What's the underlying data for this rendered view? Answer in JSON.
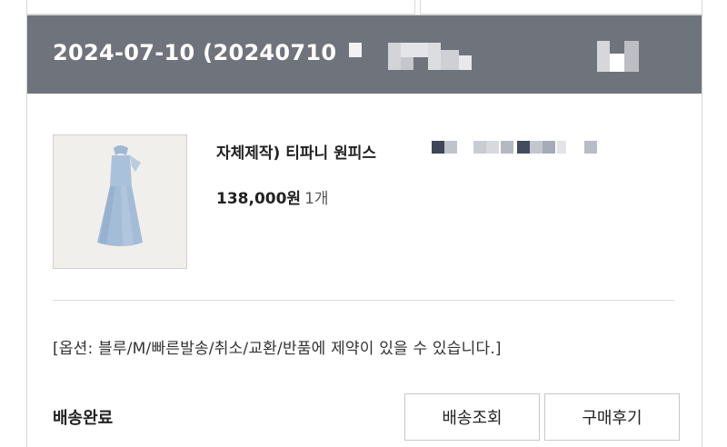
{
  "order": {
    "date": "2024-07-10 (20240710"
  },
  "product": {
    "image_alt": "light blue halter dress",
    "name": "자체제작) 티파니 원피스",
    "price": "138,000원",
    "quantity": "1개"
  },
  "option": {
    "text": "[옵션: 블루/M/빠른발송/취소/교환/반품에 제약이 있을 수 있습니다.]"
  },
  "delivery": {
    "status": "배송완료"
  },
  "buttons": {
    "track": "배송조회",
    "review": "구매후기"
  },
  "colors": {
    "header_bg": "#6f737c",
    "dress_blue": "#a9c1db"
  }
}
